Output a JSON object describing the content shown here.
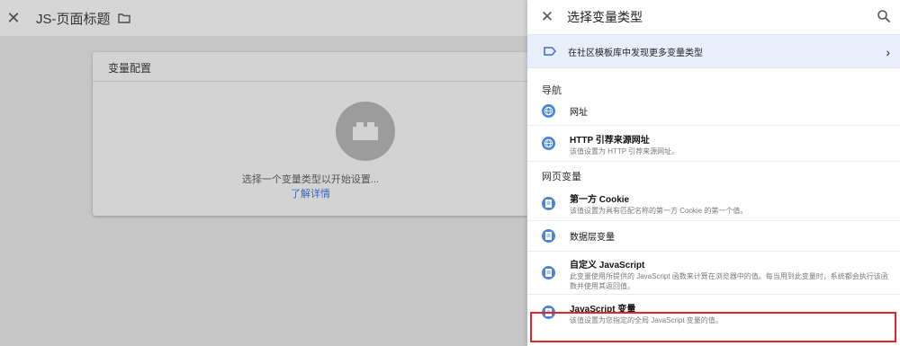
{
  "editor": {
    "title": "JS-页面标题",
    "card_title": "变量配置",
    "placeholder_text": "选择一个变量类型以开始设置...",
    "learn_more": "了解详情"
  },
  "panel": {
    "title": "选择变量类型",
    "discover_text": "在社区模板库中发现更多变量类型",
    "sections": [
      {
        "label": "导航",
        "items": [
          {
            "title": "网址",
            "desc": ""
          },
          {
            "title": "HTTP 引荐来源网址",
            "desc": "该值设置为 HTTP 引荐来源网址。"
          }
        ]
      },
      {
        "label": "网页变量",
        "items": [
          {
            "title": "第一方 Cookie",
            "desc": "该值设置为具有匹配名称的第一方 Cookie 的第一个值。"
          },
          {
            "title": "数据层变量",
            "desc": ""
          },
          {
            "title": "自定义 JavaScript",
            "desc": "此变量使用所提供的 JavaScript 函数来计算在浏览器中的值。每当用到此变量时，系统都会执行该函数并使用其返回值。"
          },
          {
            "title": "JavaScript 变量",
            "desc": "该值设置为您指定的全局 JavaScript 变量的值。"
          }
        ]
      }
    ]
  },
  "colors": {
    "accent": "#4a84d8",
    "highlight": "#e0262d",
    "discover_bg": "#e8effa",
    "link": "#3b63b8"
  },
  "icons": [
    "close-icon",
    "folder-icon",
    "search-icon",
    "tag-icon",
    "chevron-right-icon",
    "globe-icon",
    "document-icon",
    "lego-brick-icon"
  ]
}
